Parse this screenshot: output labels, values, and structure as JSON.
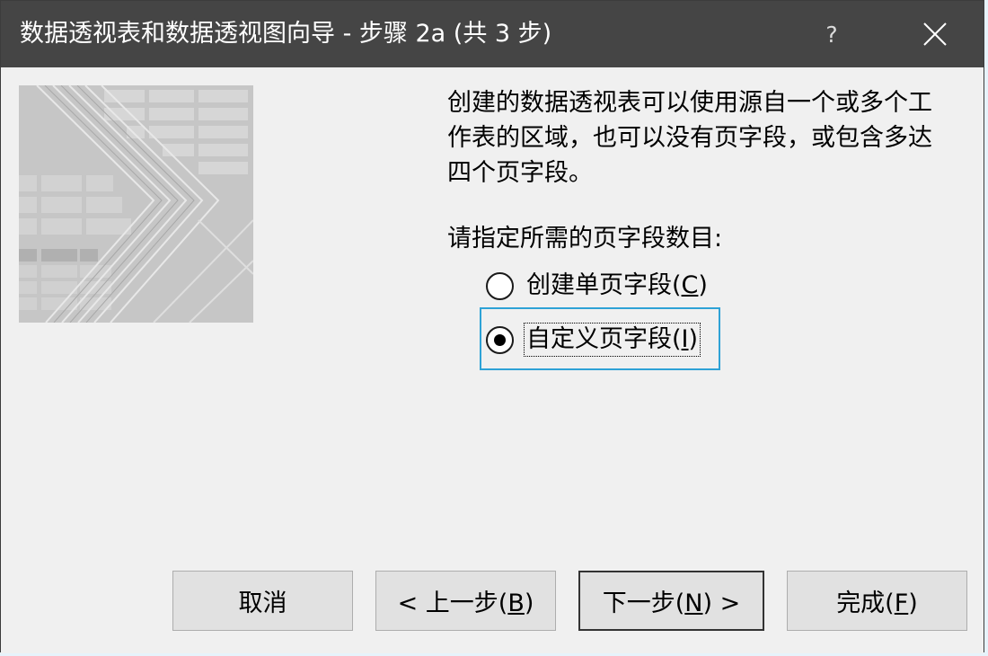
{
  "window": {
    "title": "数据透视表和数据透视图向导 - 步骤 2a (共 3 步)",
    "help_label": "?"
  },
  "content": {
    "description": "创建的数据透视表可以使用源自一个或多个工\n作表的区域，也可以没有页字段，或包含多达\n四个页字段。",
    "prompt": "请指定所需的页字段数目:",
    "options": [
      {
        "label": "创建单页字段(",
        "key": "C",
        "suffix": ")",
        "selected": false
      },
      {
        "label": "自定义页字段(",
        "key": "I",
        "suffix": ")",
        "selected": true
      }
    ]
  },
  "buttons": {
    "cancel": {
      "label": "取消"
    },
    "back": {
      "prefix": "< 上一步(",
      "key": "B",
      "suffix": ")"
    },
    "next": {
      "prefix": "下一步(",
      "key": "N",
      "suffix": ") >"
    },
    "finish": {
      "prefix": "完成(",
      "key": "F",
      "suffix": ")"
    }
  },
  "colors": {
    "titlebar": "#454545",
    "dialog_bg": "#f0f0f0",
    "focus_border": "#2ea2d6",
    "button_bg": "#e1e1e1"
  },
  "icons": [
    "close-icon",
    "help-icon",
    "wizard-illustration"
  ]
}
